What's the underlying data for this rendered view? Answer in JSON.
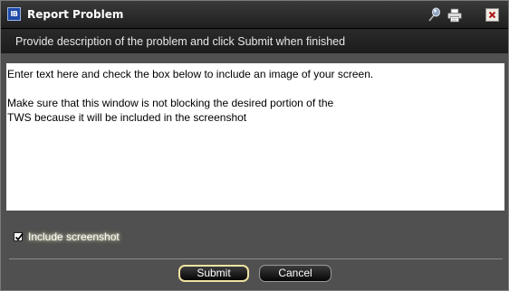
{
  "window": {
    "title": "Report Problem",
    "app_badge": "IB"
  },
  "header": {
    "instruction": "Provide description of the problem and click Submit when finished"
  },
  "description": {
    "value": "Enter text here and check the box below to include an image of your screen.\n\nMake sure that this window is not blocking the desired portion of the\nTWS because it will be included in the screenshot"
  },
  "screenshot_option": {
    "label": "Include screenshot",
    "checked": true
  },
  "buttons": {
    "submit_label": "Submit",
    "cancel_label": "Cancel"
  },
  "icons": {
    "app": "ib-logo-icon",
    "pin": "pin-icon",
    "print": "printer-icon",
    "close": "close-icon"
  },
  "colors": {
    "close_x": "#b01818",
    "submit_border": "#efe3a0"
  }
}
